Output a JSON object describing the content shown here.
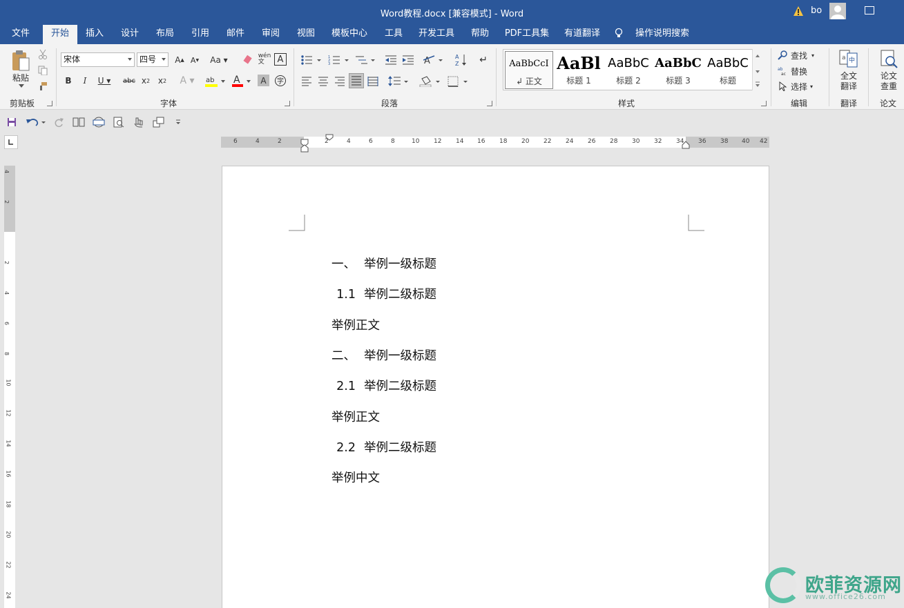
{
  "titlebar": {
    "title": "Word教程.docx [兼容模式]  -  Word",
    "user_name": "bo"
  },
  "tabs": [
    "文件",
    "开始",
    "插入",
    "设计",
    "布局",
    "引用",
    "邮件",
    "审阅",
    "视图",
    "模板中心",
    "工具",
    "开发工具",
    "帮助",
    "PDF工具集",
    "有道翻译"
  ],
  "active_tab": "开始",
  "tell_me": "操作说明搜索",
  "ribbon": {
    "clipboard": {
      "paste": "粘贴",
      "label": "剪贴板"
    },
    "font": {
      "name": "宋体",
      "size": "四号",
      "label": "字体"
    },
    "paragraph": {
      "label": "段落"
    },
    "styles": {
      "label": "样式",
      "items": [
        {
          "preview": "AaBbCcI",
          "name": "↲ 正文"
        },
        {
          "preview": "AaBl",
          "name": "标题 1"
        },
        {
          "preview": "AaBbC",
          "name": "标题 2"
        },
        {
          "preview": "AaBbC",
          "name": "标题 3"
        },
        {
          "preview": "AaBbC",
          "name": "标题"
        }
      ]
    },
    "editing": {
      "find": "查找",
      "replace": "替换",
      "select": "选择",
      "label": "编辑"
    },
    "translate": {
      "full": "全文",
      "full2": "翻译",
      "label": "翻译"
    },
    "paper": {
      "check": "论文",
      "check2": "查重",
      "label": "论文"
    }
  },
  "ruler": {
    "h_left_nums": [
      "6",
      "4",
      "2"
    ],
    "h_nums": [
      "2",
      "4",
      "6",
      "8",
      "10",
      "12",
      "14",
      "16",
      "18",
      "20",
      "22",
      "24",
      "26",
      "28",
      "30",
      "32",
      "34",
      "36",
      "38",
      "40",
      "42"
    ],
    "v_top_nums": [
      "4",
      "2"
    ],
    "v_nums": [
      "2",
      "4",
      "6",
      "8",
      "10",
      "12",
      "14",
      "16",
      "18",
      "20",
      "22",
      "24"
    ]
  },
  "document": {
    "lines": [
      {
        "num": "一、",
        "text": "举例一级标题"
      },
      {
        "num": "1.1",
        "text": "举例二级标题"
      },
      {
        "num": "",
        "text": "举例正文"
      },
      {
        "num": "二、",
        "text": "举例一级标题"
      },
      {
        "num": "2.1",
        "text": "举例二级标题"
      },
      {
        "num": "",
        "text": "举例正文"
      },
      {
        "num": "2.2",
        "text": "举例二级标题"
      },
      {
        "num": "",
        "text": "举例中文"
      }
    ]
  },
  "watermark": {
    "text": "欧菲资源网",
    "url": "www.office26.com"
  },
  "colors": {
    "brand": "#2b579a",
    "highlight": "#ffff00",
    "font_color": "#ff0000",
    "watermark": "#3ea58a"
  }
}
